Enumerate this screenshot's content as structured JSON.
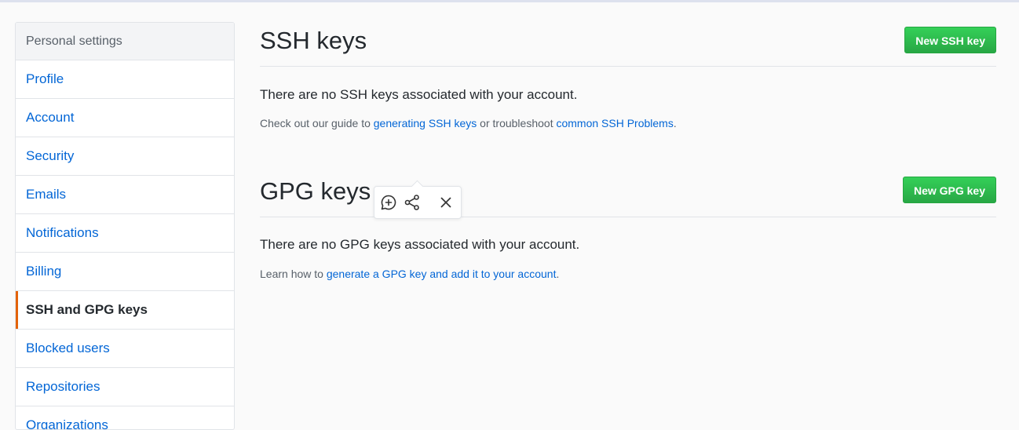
{
  "sidebar": {
    "header": "Personal settings",
    "items": [
      {
        "label": "Profile"
      },
      {
        "label": "Account"
      },
      {
        "label": "Security"
      },
      {
        "label": "Emails"
      },
      {
        "label": "Notifications"
      },
      {
        "label": "Billing"
      },
      {
        "label": "SSH and GPG keys",
        "selected": true
      },
      {
        "label": "Blocked users"
      },
      {
        "label": "Repositories"
      },
      {
        "label": "Organizations"
      }
    ]
  },
  "ssh": {
    "title": "SSH keys",
    "button": "New SSH key",
    "empty": "There are no SSH keys associated with your account.",
    "note_prefix": "Check out our guide to ",
    "link1": "generating SSH keys",
    "note_mid": " or troubleshoot ",
    "link2": "common SSH Problems",
    "note_suffix": "."
  },
  "gpg": {
    "title": "GPG keys",
    "button": "New GPG key",
    "empty": "There are no GPG keys associated with your account.",
    "note_prefix": "Learn how to ",
    "link1": "generate a GPG key and add it to your account",
    "note_suffix": "."
  },
  "popup": {
    "icons": [
      "add-comment-icon",
      "share-icon",
      "close-icon"
    ]
  },
  "colors": {
    "accent_link": "#0366d6",
    "button_green": "#28a745",
    "selected_marker": "#e36209"
  }
}
